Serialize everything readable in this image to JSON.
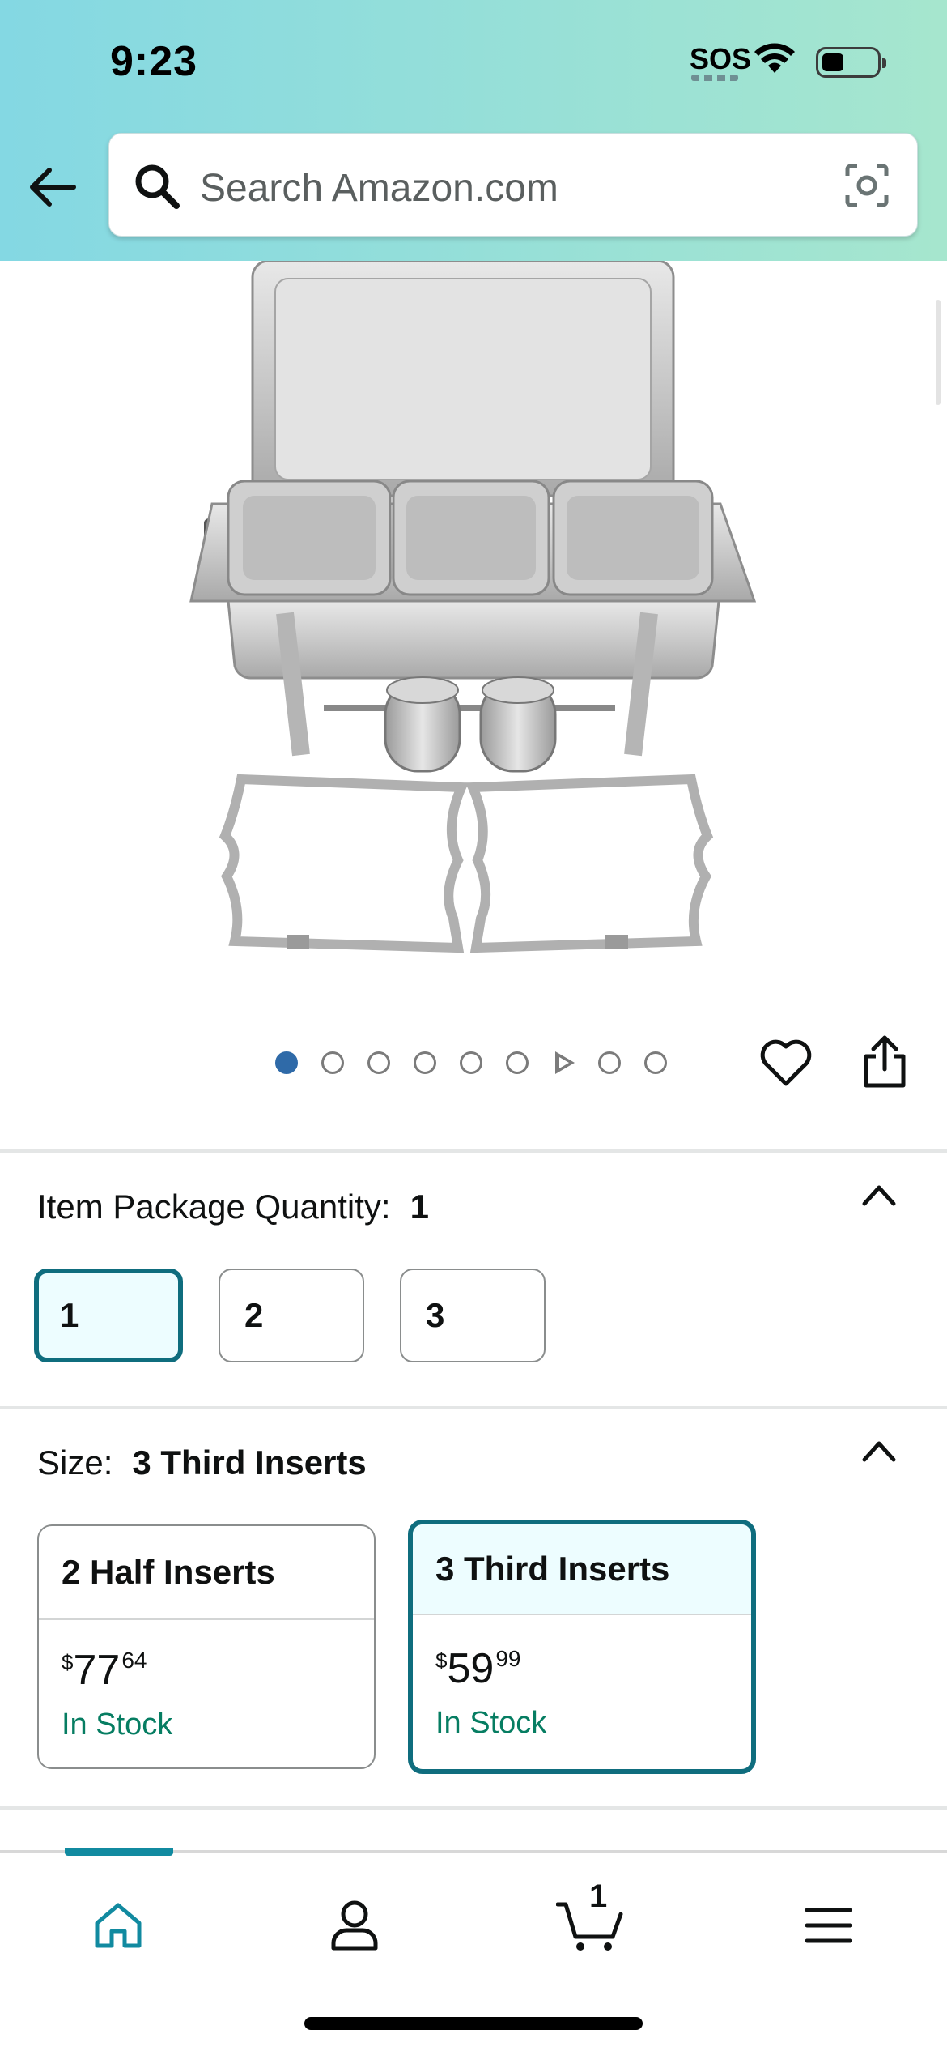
{
  "status_bar": {
    "time": "9:23",
    "sos": "SOS"
  },
  "search": {
    "placeholder": "Search Amazon.com"
  },
  "gallery": {
    "image_count": 9,
    "active_index": 0
  },
  "quantity": {
    "label": "Item Package Quantity:",
    "selected": "1",
    "options": [
      "1",
      "2",
      "3"
    ]
  },
  "size": {
    "label": "Size:",
    "selected": "3 Third Inserts",
    "options": [
      {
        "name": "2 Half Inserts",
        "currency": "$",
        "dollars": "77",
        "cents": "64",
        "stock": "In Stock"
      },
      {
        "name": "3 Third Inserts",
        "currency": "$",
        "dollars": "59",
        "cents": "99",
        "stock": "In Stock"
      }
    ]
  },
  "nav": {
    "cart_count": "1"
  },
  "colors": {
    "accent": "#0f6d7e",
    "stock_green": "#067d62",
    "dot_active": "#2f6aa8"
  }
}
